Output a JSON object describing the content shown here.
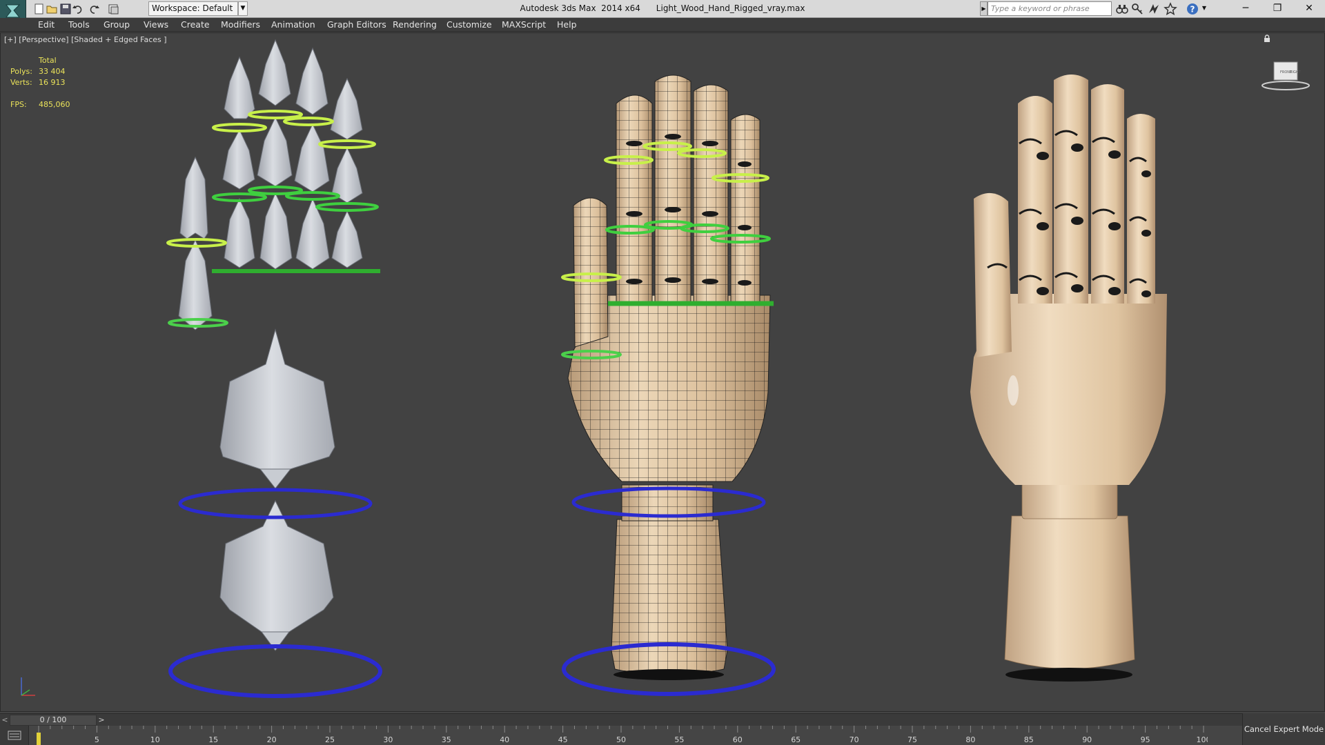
{
  "titlebar": {
    "workspace_label": "Workspace: Default",
    "app_name": "Autodesk 3ds Max  2014 x64",
    "file_name": "Light_Wood_Hand_Rigged_vray.max",
    "search_placeholder": "Type a keyword or phrase"
  },
  "menu": {
    "items": [
      "Edit",
      "Tools",
      "Group",
      "Views",
      "Create",
      "Modifiers",
      "Animation",
      "Graph Editors",
      "Rendering",
      "Customize",
      "MAXScript",
      "Help"
    ]
  },
  "viewport": {
    "label": "[+] [Perspective] [Shaded + Edged Faces ]",
    "stats": {
      "total_label": "Total",
      "polys_label": "Polys:",
      "polys_value": "33 404",
      "verts_label": "Verts:",
      "verts_value": "16 913",
      "fps_label": "FPS:",
      "fps_value": "485,060"
    },
    "viewcube": {
      "front_label": "FRONT",
      "right_label": "RIGHT"
    }
  },
  "timeline": {
    "frame_display": "0 / 100",
    "prev_symbol": "<",
    "next_symbol": ">",
    "ticks": [
      "0",
      "5",
      "10",
      "15",
      "20",
      "25",
      "30",
      "35",
      "40",
      "45",
      "50",
      "55",
      "60",
      "65",
      "70",
      "75",
      "80",
      "85",
      "90",
      "95",
      "100"
    ],
    "current_frame": 0
  },
  "status": {
    "cancel_expert_mode": "Cancel Expert Mode"
  },
  "colors": {
    "viewport_bg": "#424242",
    "stats_text": "#ebe35a",
    "wood": "#e2c9a6",
    "bone": "#c4c8cf",
    "control_yellow_green": "#c8f04a",
    "control_green": "#2fae2f",
    "control_blue": "#2b2bd0"
  }
}
